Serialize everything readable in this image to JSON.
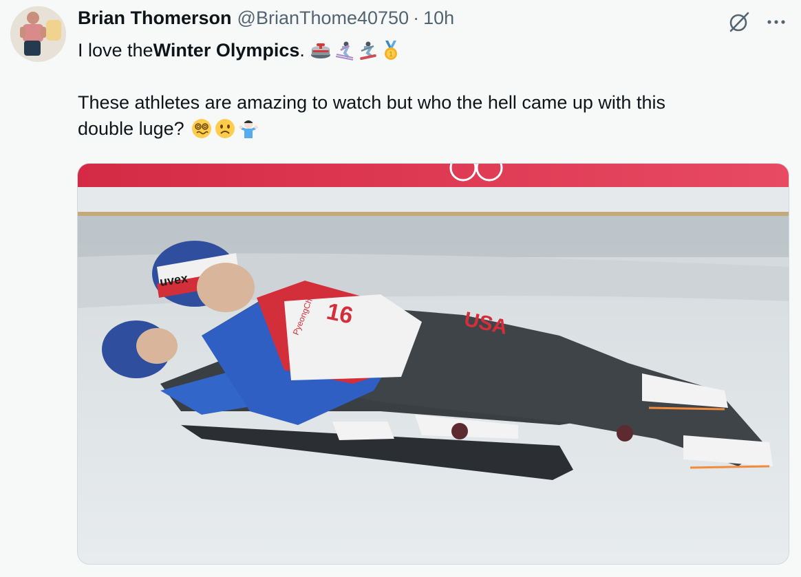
{
  "author": {
    "display_name": "Brian Thomerson",
    "handle": "@BrianThome40750",
    "separator": "·",
    "time": "10h"
  },
  "tweet": {
    "line1_prefix": "I love the ",
    "line1_bold": "Winter Olympics",
    "line1_suffix": ".",
    "line1_emojis": [
      "curling-stone-emoji",
      "skier-emoji",
      "snowboarder-emoji",
      "gold-medal-emoji"
    ],
    "line3": "These athletes are amazing to watch  but who the hell came up with this",
    "line4": "double luge?",
    "line4_emojis": [
      "face-with-spiral-eyes-emoji",
      "frowning-face-emoji",
      "man-shrugging-emoji"
    ]
  },
  "media": {
    "description_icons": [
      "olympic-rings",
      "luge-sled"
    ],
    "bib_number": "16",
    "suit_text": "USA",
    "helmet_brand": "uvex",
    "bib_event_text": "PyeongChang"
  },
  "actions": {
    "grok_icon": "grok-icon",
    "more_icon": "more-icon"
  },
  "colors": {
    "text_primary": "#0f1419",
    "text_secondary": "#536471",
    "background": "#f7f9f9",
    "banner_red": "#e4314f"
  }
}
